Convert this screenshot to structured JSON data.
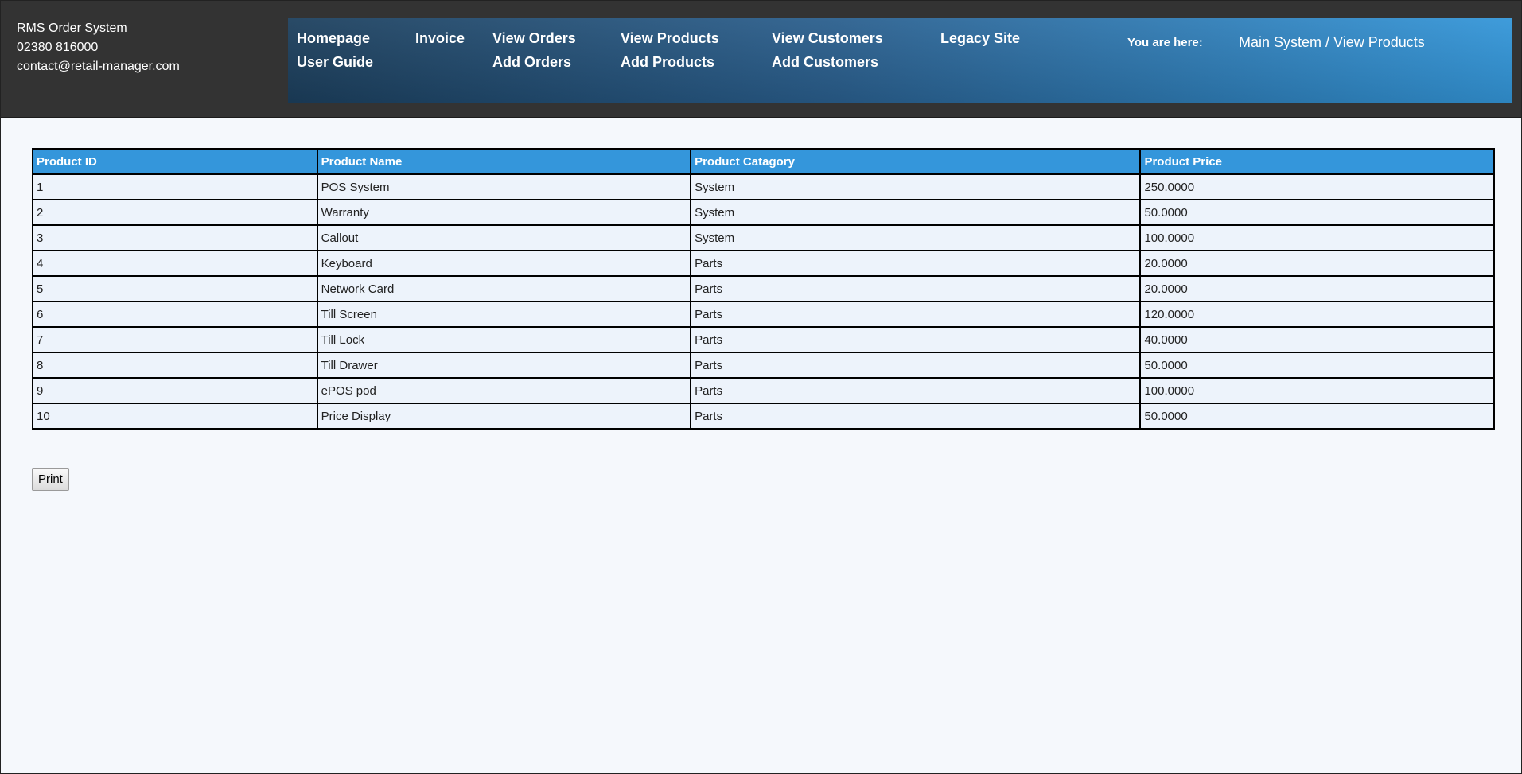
{
  "contact": {
    "title": "RMS Order System",
    "phone": "02380 816000",
    "email": "contact@retail-manager.com"
  },
  "nav": {
    "homepage": "Homepage",
    "user_guide": "User Guide",
    "invoice": "Invoice",
    "view_orders": "View Orders",
    "add_orders": "Add Orders",
    "view_products": "View Products",
    "add_products": "Add Products",
    "view_customers": "View Customers",
    "add_customers": "Add Customers",
    "legacy_site": "Legacy Site",
    "you_are_here_label": "You are here:",
    "breadcrumb": "Main System / View Products"
  },
  "table": {
    "headers": [
      "Product ID",
      "Product Name",
      "Product Catagory",
      "Product Price"
    ],
    "rows": [
      {
        "id": "1",
        "name": "POS System",
        "category": "System",
        "price": "250.0000"
      },
      {
        "id": "2",
        "name": "Warranty",
        "category": "System",
        "price": "50.0000"
      },
      {
        "id": "3",
        "name": "Callout",
        "category": "System",
        "price": "100.0000"
      },
      {
        "id": "4",
        "name": "Keyboard",
        "category": "Parts",
        "price": "20.0000"
      },
      {
        "id": "5",
        "name": "Network Card",
        "category": "Parts",
        "price": "20.0000"
      },
      {
        "id": "6",
        "name": "Till Screen",
        "category": "Parts",
        "price": "120.0000"
      },
      {
        "id": "7",
        "name": "Till Lock",
        "category": "Parts",
        "price": "40.0000"
      },
      {
        "id": "8",
        "name": "Till Drawer",
        "category": "Parts",
        "price": "50.0000"
      },
      {
        "id": "9",
        "name": "ePOS pod",
        "category": "Parts",
        "price": "100.0000"
      },
      {
        "id": "10",
        "name": "Price Display",
        "category": "Parts",
        "price": "50.0000"
      }
    ]
  },
  "actions": {
    "print_label": "Print"
  },
  "colors": {
    "header_bg": "#333333",
    "nav_gradient_start": "#1c3f5d",
    "nav_gradient_end": "#3396d9",
    "table_header_bg": "#3496db",
    "table_row_bg": "#edf3fb",
    "page_bg": "#f5f8fc"
  }
}
